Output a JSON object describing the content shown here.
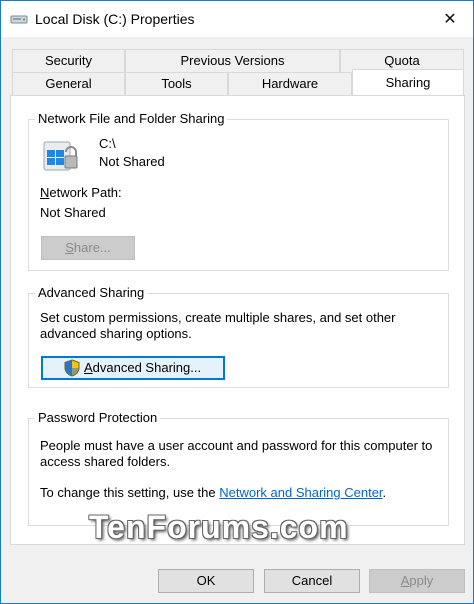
{
  "window": {
    "title": "Local Disk (C:) Properties"
  },
  "tabs": {
    "back_row": [
      {
        "label": "Security"
      },
      {
        "label": "Previous Versions"
      },
      {
        "label": "Quota"
      }
    ],
    "front_row": [
      {
        "label": "General"
      },
      {
        "label": "Tools"
      },
      {
        "label": "Hardware"
      },
      {
        "label": "Sharing"
      }
    ],
    "selected": "Sharing"
  },
  "network_sharing": {
    "group_title": "Network File and Folder Sharing",
    "drive": "C:\\",
    "status": "Not Shared",
    "path_label_first": "N",
    "path_label_rest": "etwork Path:",
    "path_value": "Not Shared",
    "share_button_first": "S",
    "share_button_rest": "hare..."
  },
  "advanced_sharing": {
    "group_title": "Advanced Sharing",
    "description_line1": "Set custom permissions, create multiple shares, and set other",
    "description_line2": "advanced sharing options.",
    "button_first": "A",
    "button_rest": "dvanced Sharing..."
  },
  "password_protection": {
    "group_title": "Password Protection",
    "text_line1": "People must have a user account and password for this computer to",
    "text_line2": "access shared folders.",
    "change_prefix": "To change this setting, use the ",
    "link_text": "Network and Sharing Center",
    "change_suffix": "."
  },
  "watermark": "TenForums.com",
  "footer": {
    "ok_label": "OK",
    "cancel_label": "Cancel",
    "apply_first": "A",
    "apply_rest": "pply"
  },
  "colors": {
    "window_border": "#1979ca",
    "link": "#0066cc",
    "focus": "#0078d7"
  }
}
